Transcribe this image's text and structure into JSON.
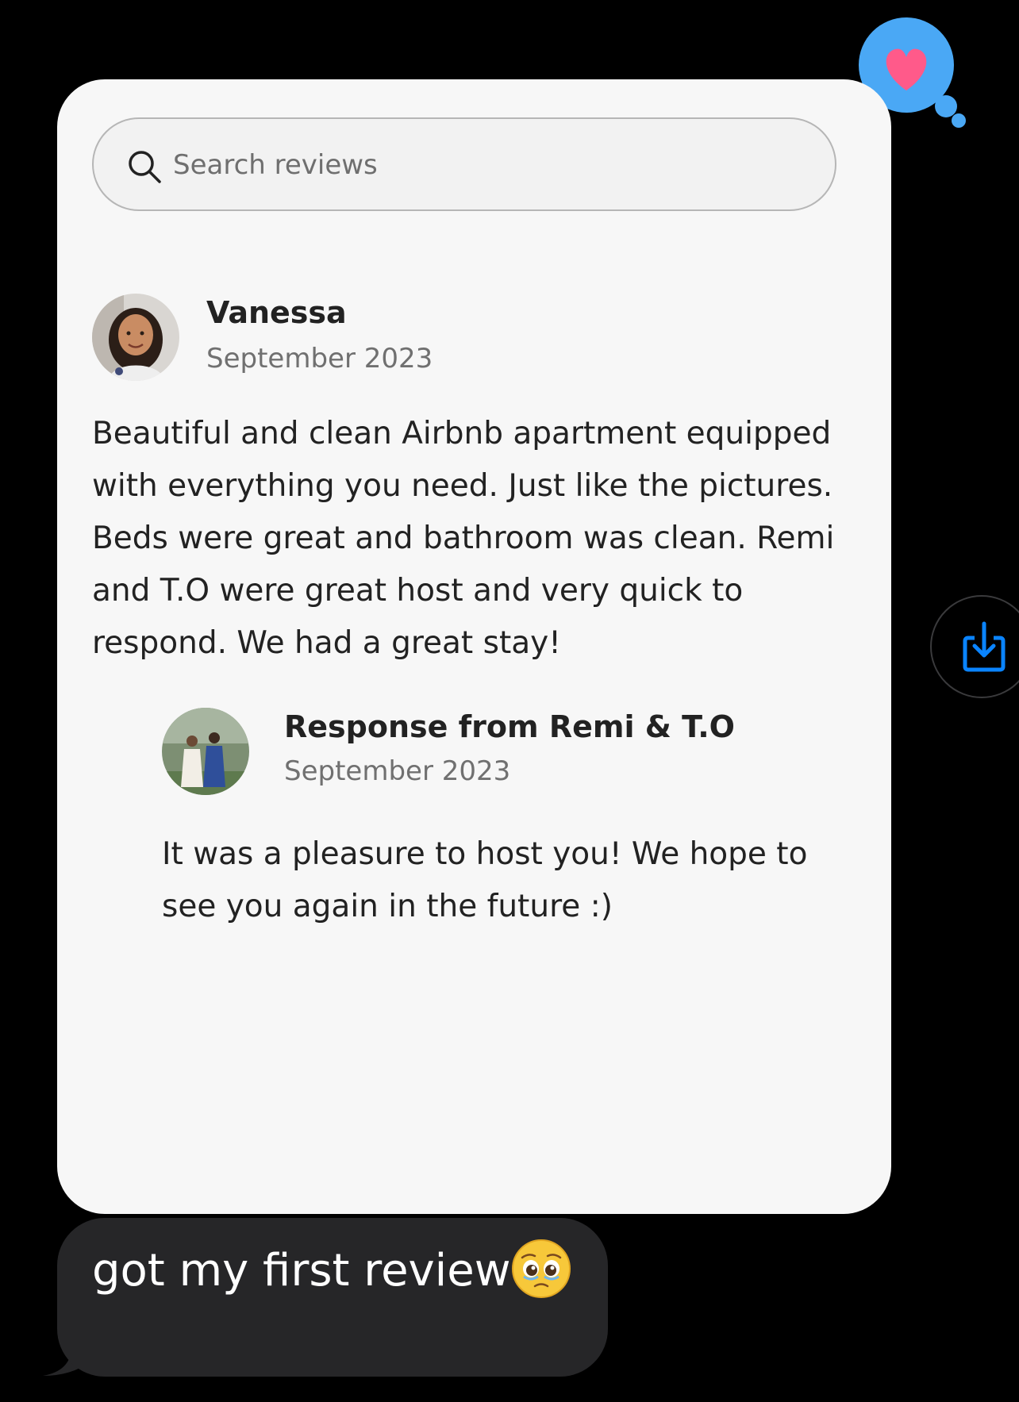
{
  "search": {
    "placeholder": "Search reviews"
  },
  "review": {
    "reviewer_name": "Vanessa",
    "date": "September 2023",
    "text": "Beautiful and clean Airbnb apartment equipped with everything you need. Just like the pictures. Beds were great and bathroom was clean. Remi and T.O were great host and very quick to respond. We had a great stay!"
  },
  "response": {
    "title": "Response from Remi & T.O",
    "date": "September 2023",
    "text": "It was a pleasure to host you! We hope to see you again in the future :)"
  },
  "reaction": {
    "icon": "heart-icon",
    "color": "#ff5a8a",
    "badge_color": "#4aa8f5"
  },
  "share": {
    "icon": "download-icon",
    "color": "#0a84ff"
  },
  "message": {
    "text": "got my first review",
    "emoji": "pleading-face-emoji",
    "bubble_color": "#262628"
  }
}
